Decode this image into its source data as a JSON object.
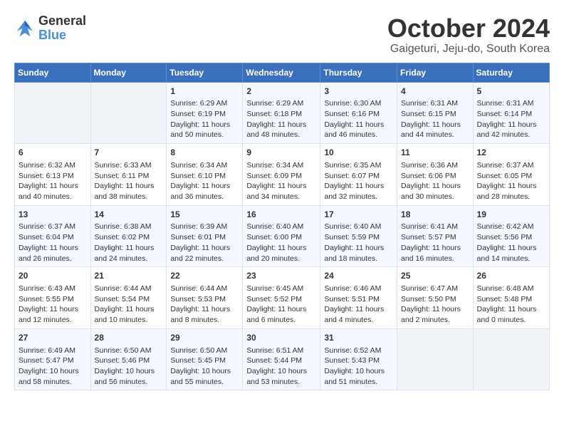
{
  "header": {
    "logo_line1": "General",
    "logo_line2": "Blue",
    "month": "October 2024",
    "location": "Gaigeturi, Jeju-do, South Korea"
  },
  "weekdays": [
    "Sunday",
    "Monday",
    "Tuesday",
    "Wednesday",
    "Thursday",
    "Friday",
    "Saturday"
  ],
  "weeks": [
    [
      {
        "day": "",
        "content": ""
      },
      {
        "day": "",
        "content": ""
      },
      {
        "day": "1",
        "content": "Sunrise: 6:29 AM\nSunset: 6:19 PM\nDaylight: 11 hours\nand 50 minutes."
      },
      {
        "day": "2",
        "content": "Sunrise: 6:29 AM\nSunset: 6:18 PM\nDaylight: 11 hours\nand 48 minutes."
      },
      {
        "day": "3",
        "content": "Sunrise: 6:30 AM\nSunset: 6:16 PM\nDaylight: 11 hours\nand 46 minutes."
      },
      {
        "day": "4",
        "content": "Sunrise: 6:31 AM\nSunset: 6:15 PM\nDaylight: 11 hours\nand 44 minutes."
      },
      {
        "day": "5",
        "content": "Sunrise: 6:31 AM\nSunset: 6:14 PM\nDaylight: 11 hours\nand 42 minutes."
      }
    ],
    [
      {
        "day": "6",
        "content": "Sunrise: 6:32 AM\nSunset: 6:13 PM\nDaylight: 11 hours\nand 40 minutes."
      },
      {
        "day": "7",
        "content": "Sunrise: 6:33 AM\nSunset: 6:11 PM\nDaylight: 11 hours\nand 38 minutes."
      },
      {
        "day": "8",
        "content": "Sunrise: 6:34 AM\nSunset: 6:10 PM\nDaylight: 11 hours\nand 36 minutes."
      },
      {
        "day": "9",
        "content": "Sunrise: 6:34 AM\nSunset: 6:09 PM\nDaylight: 11 hours\nand 34 minutes."
      },
      {
        "day": "10",
        "content": "Sunrise: 6:35 AM\nSunset: 6:07 PM\nDaylight: 11 hours\nand 32 minutes."
      },
      {
        "day": "11",
        "content": "Sunrise: 6:36 AM\nSunset: 6:06 PM\nDaylight: 11 hours\nand 30 minutes."
      },
      {
        "day": "12",
        "content": "Sunrise: 6:37 AM\nSunset: 6:05 PM\nDaylight: 11 hours\nand 28 minutes."
      }
    ],
    [
      {
        "day": "13",
        "content": "Sunrise: 6:37 AM\nSunset: 6:04 PM\nDaylight: 11 hours\nand 26 minutes."
      },
      {
        "day": "14",
        "content": "Sunrise: 6:38 AM\nSunset: 6:02 PM\nDaylight: 11 hours\nand 24 minutes."
      },
      {
        "day": "15",
        "content": "Sunrise: 6:39 AM\nSunset: 6:01 PM\nDaylight: 11 hours\nand 22 minutes."
      },
      {
        "day": "16",
        "content": "Sunrise: 6:40 AM\nSunset: 6:00 PM\nDaylight: 11 hours\nand 20 minutes."
      },
      {
        "day": "17",
        "content": "Sunrise: 6:40 AM\nSunset: 5:59 PM\nDaylight: 11 hours\nand 18 minutes."
      },
      {
        "day": "18",
        "content": "Sunrise: 6:41 AM\nSunset: 5:57 PM\nDaylight: 11 hours\nand 16 minutes."
      },
      {
        "day": "19",
        "content": "Sunrise: 6:42 AM\nSunset: 5:56 PM\nDaylight: 11 hours\nand 14 minutes."
      }
    ],
    [
      {
        "day": "20",
        "content": "Sunrise: 6:43 AM\nSunset: 5:55 PM\nDaylight: 11 hours\nand 12 minutes."
      },
      {
        "day": "21",
        "content": "Sunrise: 6:44 AM\nSunset: 5:54 PM\nDaylight: 11 hours\nand 10 minutes."
      },
      {
        "day": "22",
        "content": "Sunrise: 6:44 AM\nSunset: 5:53 PM\nDaylight: 11 hours\nand 8 minutes."
      },
      {
        "day": "23",
        "content": "Sunrise: 6:45 AM\nSunset: 5:52 PM\nDaylight: 11 hours\nand 6 minutes."
      },
      {
        "day": "24",
        "content": "Sunrise: 6:46 AM\nSunset: 5:51 PM\nDaylight: 11 hours\nand 4 minutes."
      },
      {
        "day": "25",
        "content": "Sunrise: 6:47 AM\nSunset: 5:50 PM\nDaylight: 11 hours\nand 2 minutes."
      },
      {
        "day": "26",
        "content": "Sunrise: 6:48 AM\nSunset: 5:48 PM\nDaylight: 11 hours\nand 0 minutes."
      }
    ],
    [
      {
        "day": "27",
        "content": "Sunrise: 6:49 AM\nSunset: 5:47 PM\nDaylight: 10 hours\nand 58 minutes."
      },
      {
        "day": "28",
        "content": "Sunrise: 6:50 AM\nSunset: 5:46 PM\nDaylight: 10 hours\nand 56 minutes."
      },
      {
        "day": "29",
        "content": "Sunrise: 6:50 AM\nSunset: 5:45 PM\nDaylight: 10 hours\nand 55 minutes."
      },
      {
        "day": "30",
        "content": "Sunrise: 6:51 AM\nSunset: 5:44 PM\nDaylight: 10 hours\nand 53 minutes."
      },
      {
        "day": "31",
        "content": "Sunrise: 6:52 AM\nSunset: 5:43 PM\nDaylight: 10 hours\nand 51 minutes."
      },
      {
        "day": "",
        "content": ""
      },
      {
        "day": "",
        "content": ""
      }
    ]
  ]
}
